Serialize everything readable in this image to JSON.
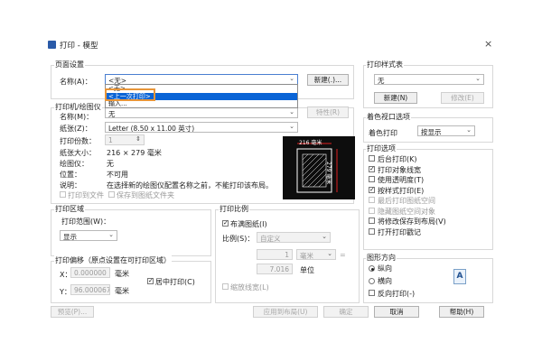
{
  "window": {
    "title": "打印 - 模型",
    "close": "×"
  },
  "page_setup": {
    "group_title": "页面设置",
    "name_label": "名称(A)：",
    "name_value": "<无>",
    "add_button": "新建(.)...",
    "dropdown_items": [
      "<无>",
      "<上一次打印>",
      "输入..."
    ]
  },
  "printer": {
    "group_title": "打印机/绘图仪",
    "name_label": "名称(M)：",
    "name_value": "无",
    "properties_button": "特性(R)",
    "paper_label": "纸张(Z)：",
    "paper_value": "Letter (8.50 x 11.00 英寸)",
    "copies_label": "打印份数：",
    "copies_value": "1",
    "paper_size_label": "纸张大小：",
    "paper_size_value": "216 × 279  毫米",
    "plotter_label": "绘图仪：",
    "plotter_value": "无",
    "where_label": "位置：",
    "where_value": "不可用",
    "desc_label": "说明：",
    "desc_value": "在选择新的绘图仪配置名称之前，不能打印该布局。",
    "print_to_file": "打印到文件",
    "save_to_folder": "保存到图纸文件夹",
    "preview_w": "216 毫米",
    "preview_h": "279 毫米"
  },
  "plot_area": {
    "group_title": "打印区域",
    "range_label": "打印范围(W)：",
    "range_value": "显示"
  },
  "plot_offset": {
    "group_title": "打印偏移（原点设置在可打印区域）",
    "x_label": "X：",
    "x_value": "0.000000",
    "x_unit": "毫米",
    "y_label": "Y：",
    "y_value": "96.000067",
    "y_unit": "毫米",
    "center_label": "居中打印(C)"
  },
  "plot_scale": {
    "group_title": "打印比例",
    "fit_label": "布满图纸(I)",
    "scale_label": "比例(S)：",
    "scale_value": "自定义",
    "val1": "1",
    "unit1": "毫米",
    "equals": "=",
    "val2": "7.016",
    "unit2": "单位",
    "lineweights": "缩放线宽(L)"
  },
  "plot_style": {
    "group_title": "打印样式表",
    "value": "无",
    "new_button": "新建(N)",
    "edit_button": "修改(E)"
  },
  "shaded": {
    "group_title": "着色视口选项",
    "shade_label": "着色打印",
    "shade_value": "按显示"
  },
  "plot_options": {
    "group_title": "打印选项",
    "items": [
      {
        "label": "后台打印(K)",
        "checked": false,
        "disabled": false
      },
      {
        "label": "打印对象线宽",
        "checked": true,
        "disabled": false
      },
      {
        "label": "使用透明度(T)",
        "checked": false,
        "disabled": false
      },
      {
        "label": "按样式打印(E)",
        "checked": true,
        "disabled": false
      },
      {
        "label": "最后打印图纸空间",
        "checked": false,
        "disabled": true
      },
      {
        "label": "隐藏图纸空间对象",
        "checked": false,
        "disabled": true
      },
      {
        "label": "将修改保存到布局(V)",
        "checked": false,
        "disabled": false
      },
      {
        "label": "打开打印戳记",
        "checked": false,
        "disabled": false
      }
    ]
  },
  "orientation": {
    "group_title": "图形方向",
    "portrait": "纵向",
    "landscape": "横向",
    "upside_down": "反向打印(-)",
    "icon_letter": "A"
  },
  "buttons": {
    "preview": "预览(P)...",
    "apply": "应用到布局(U)",
    "ok": "确定",
    "cancel": "取消",
    "help": "帮助(H)"
  }
}
